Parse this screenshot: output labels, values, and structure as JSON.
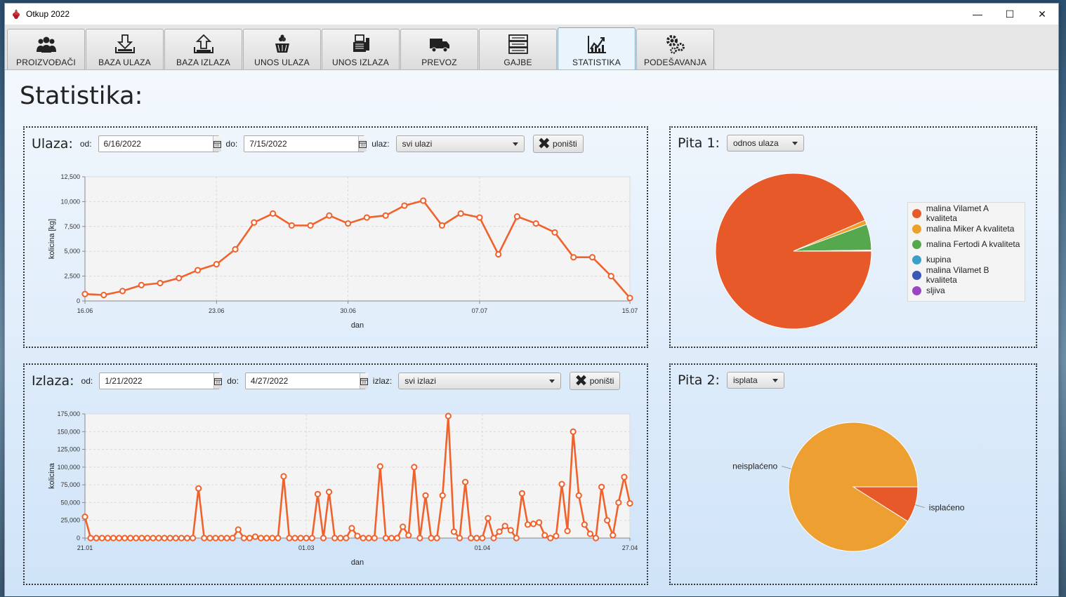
{
  "window": {
    "title": "Otkup 2022",
    "minimize": "—",
    "maximize": "☐",
    "close": "✕"
  },
  "tabs": [
    {
      "label": "PROIZVOĐAČI",
      "icon": "users-icon"
    },
    {
      "label": "BAZA ULAZA",
      "icon": "download-tray-icon"
    },
    {
      "label": "BAZA IZLAZA",
      "icon": "upload-tray-icon"
    },
    {
      "label": "UNOS ULAZA",
      "icon": "fruit-basket-icon"
    },
    {
      "label": "UNOS IZLAZA",
      "icon": "register-icon"
    },
    {
      "label": "PREVOZ",
      "icon": "truck-icon"
    },
    {
      "label": "GAJBE",
      "icon": "crates-icon"
    },
    {
      "label": "STATISTIKA",
      "icon": "chart-icon"
    },
    {
      "label": "PODEŠAVANJA",
      "icon": "gears-icon"
    }
  ],
  "active_tab": "STATISTIKA",
  "page_title": "Statistika:",
  "ulaz_panel": {
    "title": "Ulaza:",
    "od_label": "od:",
    "od_value": "6/16/2022",
    "do_label": "do:",
    "do_value": "7/15/2022",
    "filter_label": "ulaz:",
    "filter_value": "svi ulazi",
    "reset_label": "poništi"
  },
  "izlaz_panel": {
    "title": "Izlaza:",
    "od_label": "od:",
    "od_value": "1/21/2022",
    "do_label": "do:",
    "do_value": "4/27/2022",
    "filter_label": "izlaz:",
    "filter_value": "svi izlazi",
    "reset_label": "poništi"
  },
  "pie1_panel": {
    "title": "Pita 1:",
    "select_value": "odnos ulaza"
  },
  "pie2_panel": {
    "title": "Pita 2:",
    "select_value": "isplata"
  },
  "chart_data": [
    {
      "type": "line",
      "xlabel": "dan",
      "ylabel": "kolicina [kg]",
      "ylim": [
        0,
        12500
      ],
      "yticks": [
        0,
        2500,
        5000,
        7500,
        10000,
        12500
      ],
      "ytick_labels": [
        "0",
        "2,500",
        "5,000",
        "7,500",
        "10,000",
        "12,500"
      ],
      "xlim": [
        0,
        29
      ],
      "xticks": [
        0,
        7,
        14,
        21,
        29
      ],
      "xtick_labels": [
        "16.06",
        "23.06",
        "30.06",
        "07.07",
        "15.07"
      ],
      "color": "#f0622c",
      "x": [
        0,
        1,
        2,
        3,
        4,
        5,
        6,
        7,
        8,
        9,
        10,
        11,
        12,
        13,
        14,
        15,
        16,
        17,
        18,
        19,
        20,
        21,
        22,
        23,
        24,
        25,
        26,
        27,
        28,
        29
      ],
      "y": [
        700,
        600,
        1000,
        1600,
        1800,
        2300,
        3100,
        3700,
        5200,
        7900,
        8800,
        7600,
        7600,
        8600,
        7800,
        8400,
        8600,
        9600,
        10100,
        7600,
        8800,
        8400,
        4700,
        8500,
        7800,
        6900,
        4400,
        4400,
        2500,
        300
      ]
    },
    {
      "type": "line",
      "xlabel": "dan",
      "ylabel": "kolicina",
      "ylim": [
        0,
        175000
      ],
      "yticks": [
        0,
        25000,
        50000,
        75000,
        100000,
        125000,
        150000,
        175000
      ],
      "ytick_labels": [
        "0",
        "25,000",
        "50,000",
        "75,000",
        "100,000",
        "125,000",
        "150,000",
        "175,000"
      ],
      "xlim": [
        0,
        96
      ],
      "xticks": [
        0,
        39,
        70,
        96
      ],
      "xtick_labels": [
        "21.01",
        "01.03",
        "01.04",
        "27.04"
      ],
      "color": "#f0622c",
      "x": [
        0,
        1,
        2,
        3,
        4,
        5,
        6,
        7,
        8,
        9,
        10,
        11,
        12,
        13,
        14,
        15,
        16,
        17,
        18,
        19,
        20,
        21,
        22,
        23,
        24,
        25,
        26,
        27,
        28,
        29,
        30,
        31,
        32,
        33,
        34,
        35,
        36,
        37,
        38,
        39,
        40,
        41,
        42,
        43,
        44,
        45,
        46,
        47,
        48,
        49,
        50,
        51,
        52,
        53,
        54,
        55,
        56,
        57,
        58,
        59,
        60,
        61,
        62,
        63,
        64,
        65,
        66,
        67,
        68,
        69,
        70,
        71,
        72,
        73,
        74,
        75,
        76,
        77,
        78,
        79,
        80,
        81,
        82,
        83,
        84,
        85,
        86,
        87,
        88,
        89,
        90,
        91,
        92,
        93,
        94,
        95,
        96
      ],
      "y": [
        30000,
        0,
        0,
        0,
        0,
        0,
        0,
        0,
        0,
        0,
        0,
        0,
        0,
        0,
        0,
        0,
        0,
        0,
        0,
        0,
        70000,
        0,
        0,
        0,
        0,
        0,
        0,
        12000,
        0,
        0,
        2000,
        0,
        0,
        0,
        0,
        87000,
        0,
        0,
        0,
        0,
        0,
        62000,
        0,
        65000,
        0,
        0,
        0,
        14000,
        3000,
        0,
        0,
        0,
        101000,
        0,
        0,
        0,
        16000,
        4000,
        100000,
        0,
        60000,
        0,
        0,
        60000,
        172000,
        9000,
        0,
        79000,
        0,
        0,
        0,
        28000,
        0,
        9000,
        17000,
        11000,
        0,
        63000,
        19000,
        20000,
        22000,
        4000,
        0,
        3000,
        76000,
        10000,
        150000,
        60000,
        19000,
        6000,
        0,
        72000,
        25000,
        4000,
        50000,
        86000,
        49000
      ]
    },
    {
      "type": "pie",
      "labels": [
        "malina Vilamet A kvaliteta",
        "malina Miker A kvaliteta",
        "malina Fertodi A kvaliteta",
        "kupina",
        "malina Vilamet B kvaliteta",
        "sljiva"
      ],
      "values": [
        93.5,
        0.9,
        5.4,
        0.1,
        0.05,
        0.05
      ],
      "colors": [
        "#e8592a",
        "#eea02b",
        "#56a84f",
        "#3aa0c7",
        "#3a57b5",
        "#9a45c2"
      ],
      "legend": "right"
    },
    {
      "type": "pie",
      "labels": [
        "isplaćeno",
        "neisplaćeno"
      ],
      "values": [
        9,
        91
      ],
      "colors": [
        "#e8592a",
        "#eda031"
      ],
      "legend": "none"
    }
  ]
}
